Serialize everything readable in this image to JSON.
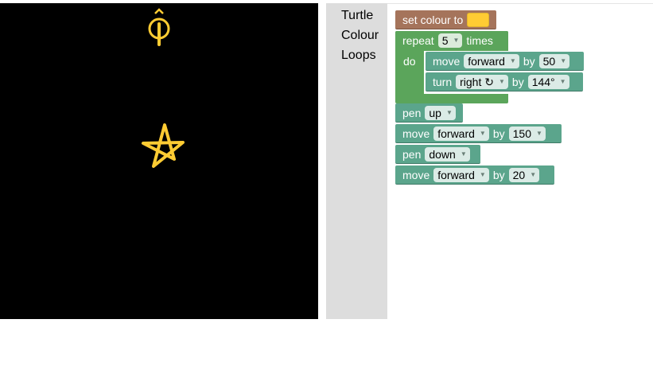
{
  "toolbox": {
    "categories": [
      "Turtle",
      "Colour",
      "Loops"
    ]
  },
  "colors": {
    "canvas_bg": "#000000",
    "pen_colour": "#ffcc33",
    "turtle_block": "#5ba58c",
    "colour_block": "#a5745b",
    "loop_block": "#5ba55b",
    "toolbox_bg": "#dddddd"
  },
  "blocks": {
    "set_colour": {
      "label": "set colour to",
      "value": "#ffcc33"
    },
    "repeat": {
      "label": "repeat",
      "count": "5",
      "suffix": "times",
      "do_label": "do"
    },
    "move1": {
      "label": "move",
      "direction": "forward",
      "by": "by",
      "amount": "50"
    },
    "turn1": {
      "label": "turn",
      "direction": "right ↻",
      "by": "by",
      "amount": "144°"
    },
    "pen1": {
      "label": "pen",
      "state": "up"
    },
    "move2": {
      "label": "move",
      "direction": "forward",
      "by": "by",
      "amount": "150"
    },
    "pen2": {
      "label": "pen",
      "state": "down"
    },
    "move3": {
      "label": "move",
      "direction": "forward",
      "by": "by",
      "amount": "20"
    }
  }
}
